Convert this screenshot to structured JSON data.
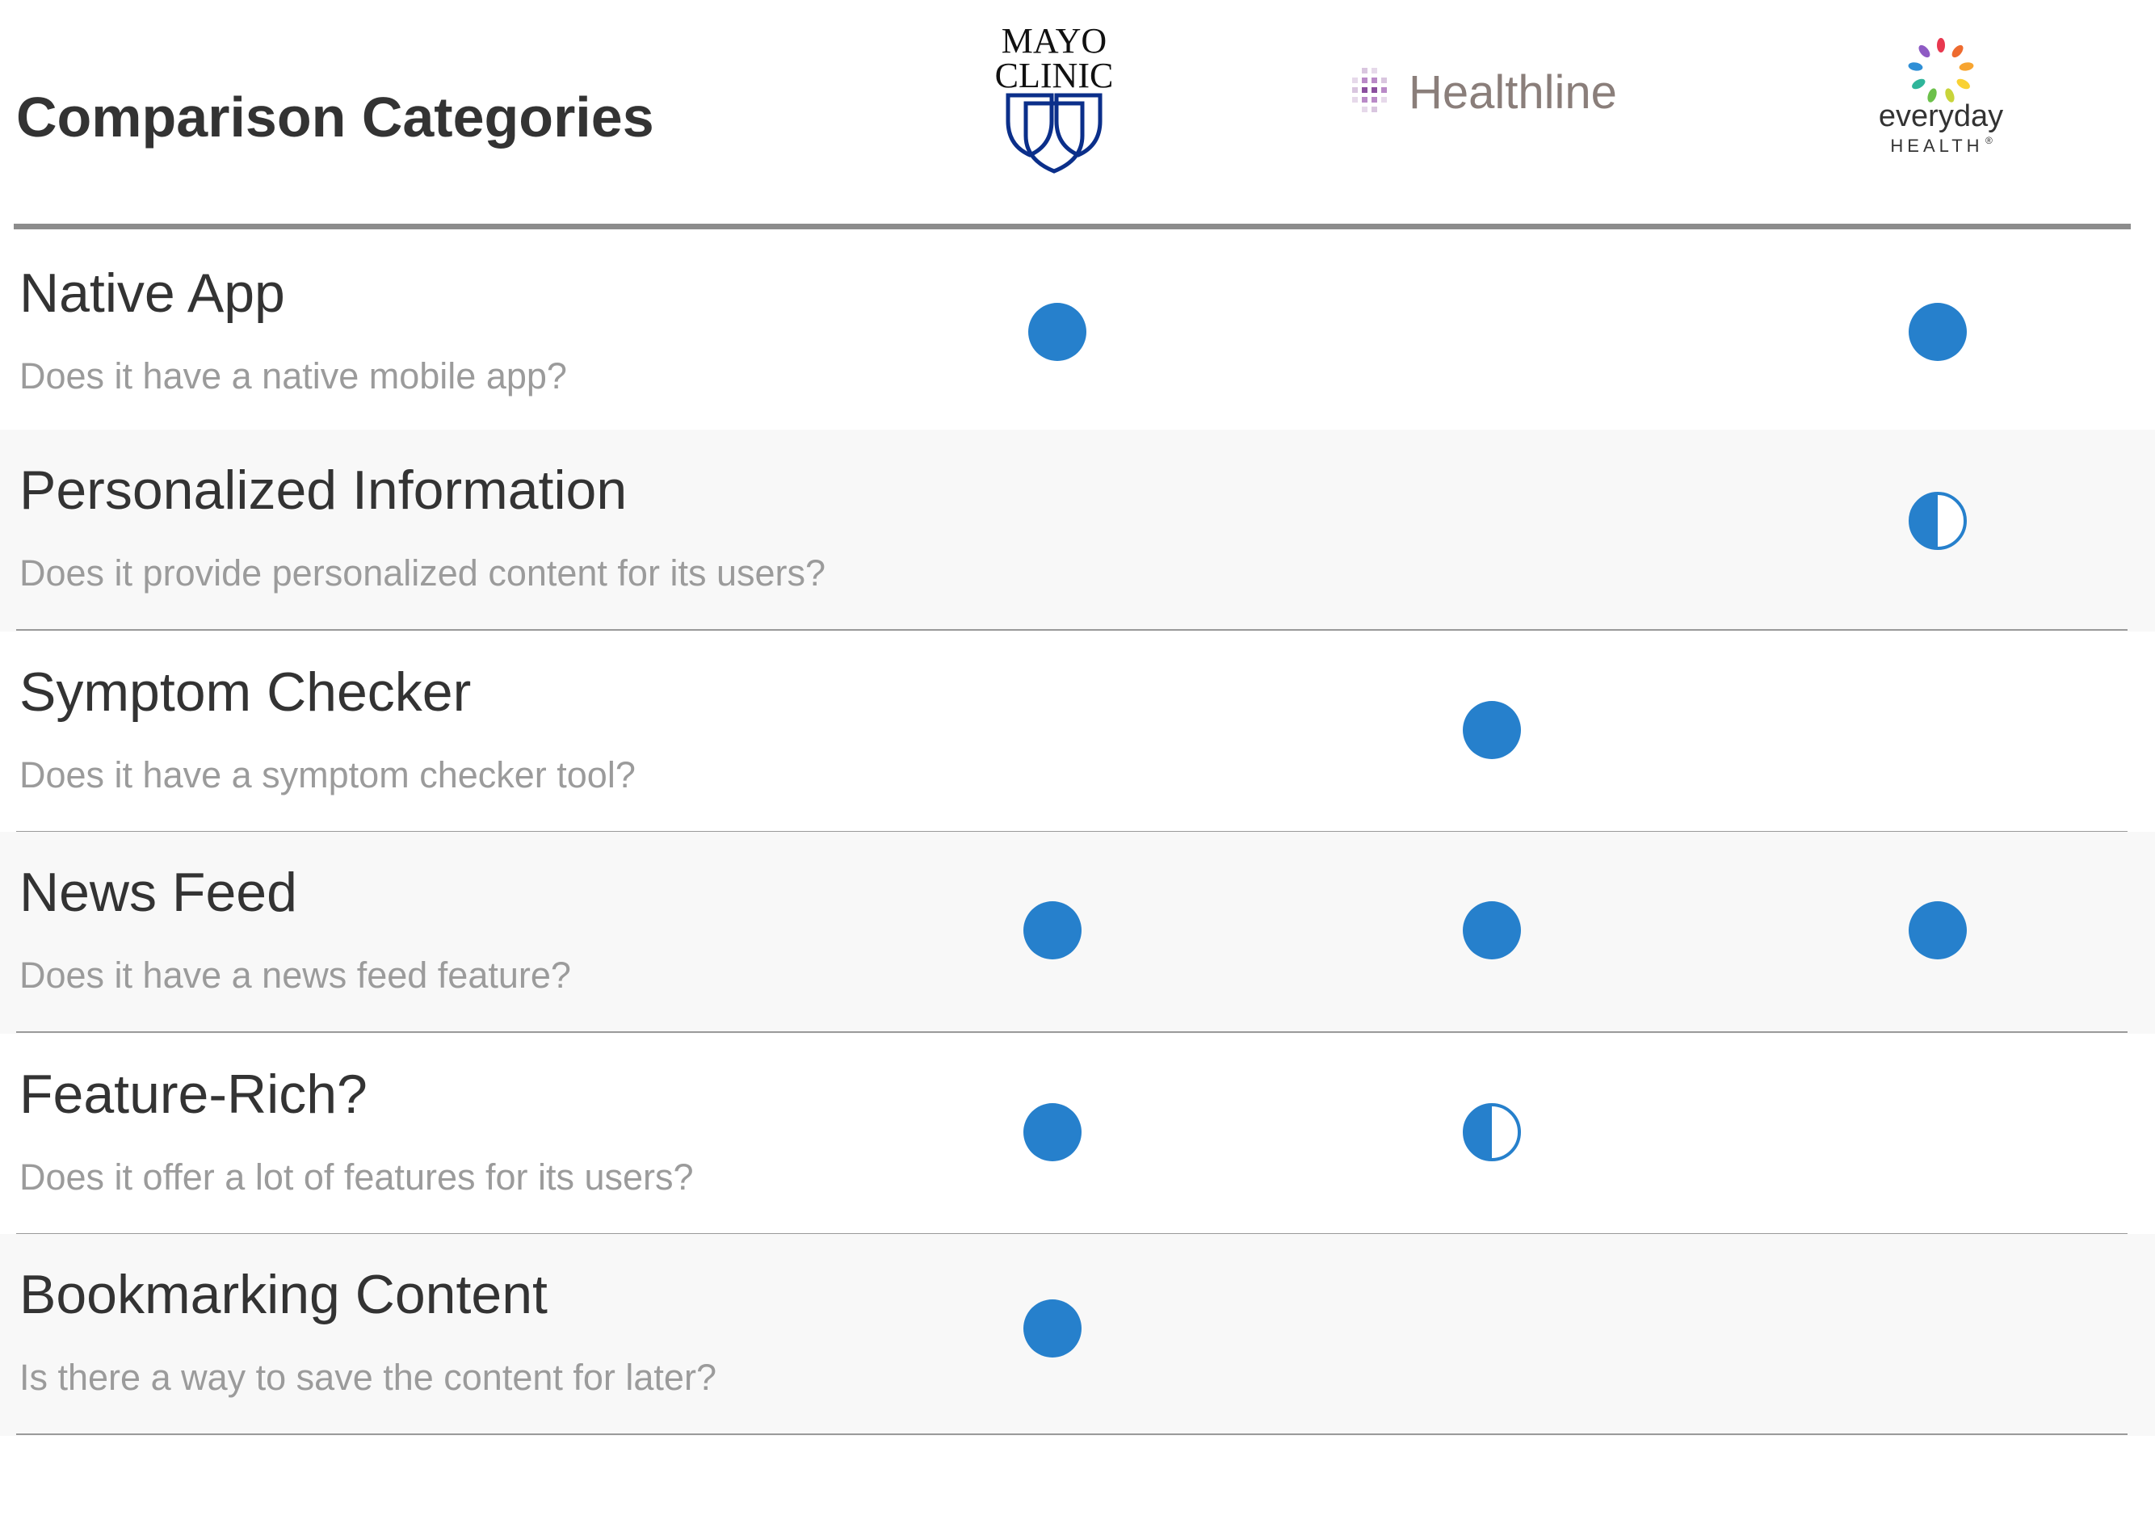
{
  "header": {
    "title": "Comparison Categories"
  },
  "providers": [
    {
      "key": "mayo",
      "logo_lines": [
        "MAYO",
        "CLINIC"
      ],
      "logo_color": "#0b2f8a"
    },
    {
      "key": "healthline",
      "logo_text": "Healthline",
      "logo_color": "#8a7e7a",
      "accent_color": "#8a4f9e"
    },
    {
      "key": "everyday",
      "logo_line1": "everyday",
      "logo_line2": "HEALTH",
      "logo_mark": "®",
      "logo_color": "#333333"
    }
  ],
  "colors": {
    "full": "#2680cc",
    "divider": "#9a9a9a",
    "header_rule": "#8c8c8c",
    "shaded_row": "#f8f8f8"
  },
  "rows": [
    {
      "title": "Native App",
      "subtitle": "Does it have a native mobile app?",
      "ratings": {
        "mayo": "full",
        "healthline": "none",
        "everyday": "full"
      }
    },
    {
      "title": "Personalized Information",
      "subtitle": "Does it provide personalized content for its users?",
      "ratings": {
        "mayo": "none",
        "healthline": "none",
        "everyday": "half"
      }
    },
    {
      "title": "Symptom Checker",
      "subtitle": "Does it have a symptom checker tool?",
      "ratings": {
        "mayo": "none",
        "healthline": "full",
        "everyday": "none"
      }
    },
    {
      "title": "News Feed",
      "subtitle": "Does it have a news feed feature?",
      "ratings": {
        "mayo": "full",
        "healthline": "full",
        "everyday": "full"
      }
    },
    {
      "title": "Feature-Rich?",
      "subtitle": "Does it offer a lot of features for its users?",
      "ratings": {
        "mayo": "full",
        "healthline": "half",
        "everyday": "none"
      }
    },
    {
      "title": "Bookmarking Content",
      "subtitle": "Is there a way to save the content for later?",
      "ratings": {
        "mayo": "full",
        "healthline": "none",
        "everyday": "none"
      }
    }
  ]
}
